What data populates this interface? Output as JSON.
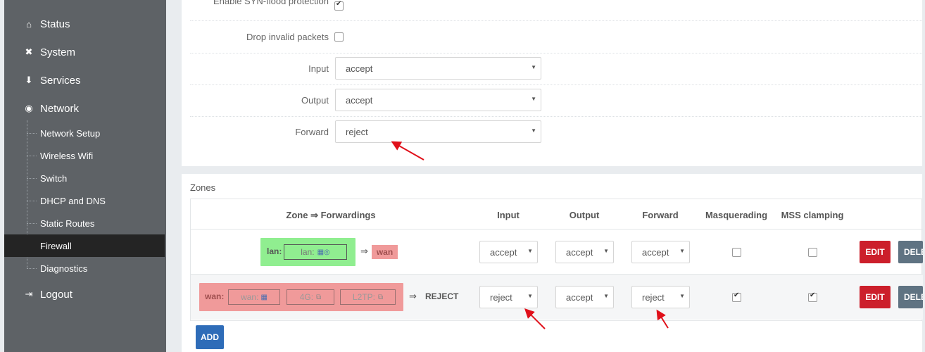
{
  "sidebar": {
    "status": "Status",
    "system": "System",
    "services": "Services",
    "network": "Network",
    "sub": [
      "Network Setup",
      "Wireless Wifi",
      "Switch",
      "DHCP and DNS",
      "Static Routes",
      "Firewall",
      "Diagnostics"
    ],
    "logout": "Logout"
  },
  "general": {
    "synflood_label": "Enable SYN-flood protection",
    "synflood_checked": true,
    "drop_invalid_label": "Drop invalid packets",
    "drop_invalid_checked": false,
    "input_label": "Input",
    "input_value": "accept",
    "output_label": "Output",
    "output_value": "accept",
    "forward_label": "Forward",
    "forward_value": "reject"
  },
  "zones": {
    "title": "Zones",
    "headers": {
      "zone_forwardings": "Zone ⇒ Forwardings",
      "input": "Input",
      "output": "Output",
      "forward": "Forward",
      "masquerading": "Masquerading",
      "mss_clamping": "MSS clamping"
    },
    "rows": [
      {
        "zone": "lan:",
        "networks": [
          "lan:"
        ],
        "arrow": "⇒",
        "target": "wan",
        "input": "accept",
        "output": "accept",
        "forward": "accept",
        "masquerading": false,
        "mss_clamping": false,
        "edit": "EDIT",
        "delete": "DELETE"
      },
      {
        "zone": "wan:",
        "networks": [
          "wan:",
          "4G:",
          "L2TP:"
        ],
        "arrow": "⇒",
        "target": "REJECT",
        "input": "reject",
        "output": "accept",
        "forward": "reject",
        "masquerading": true,
        "mss_clamping": true,
        "edit": "EDIT",
        "delete": "DELETE"
      }
    ],
    "add_label": "ADD"
  },
  "colors": {
    "sidebar_bg": "#5e6266",
    "active_bg": "#242424",
    "zone_lan": "#90ee90",
    "zone_wan": "#f09a9a",
    "edit_btn": "#cc1f2b",
    "delete_btn": "#5f7382",
    "add_btn": "#2e6cb8",
    "annotation_arrow": "#e0101a"
  }
}
